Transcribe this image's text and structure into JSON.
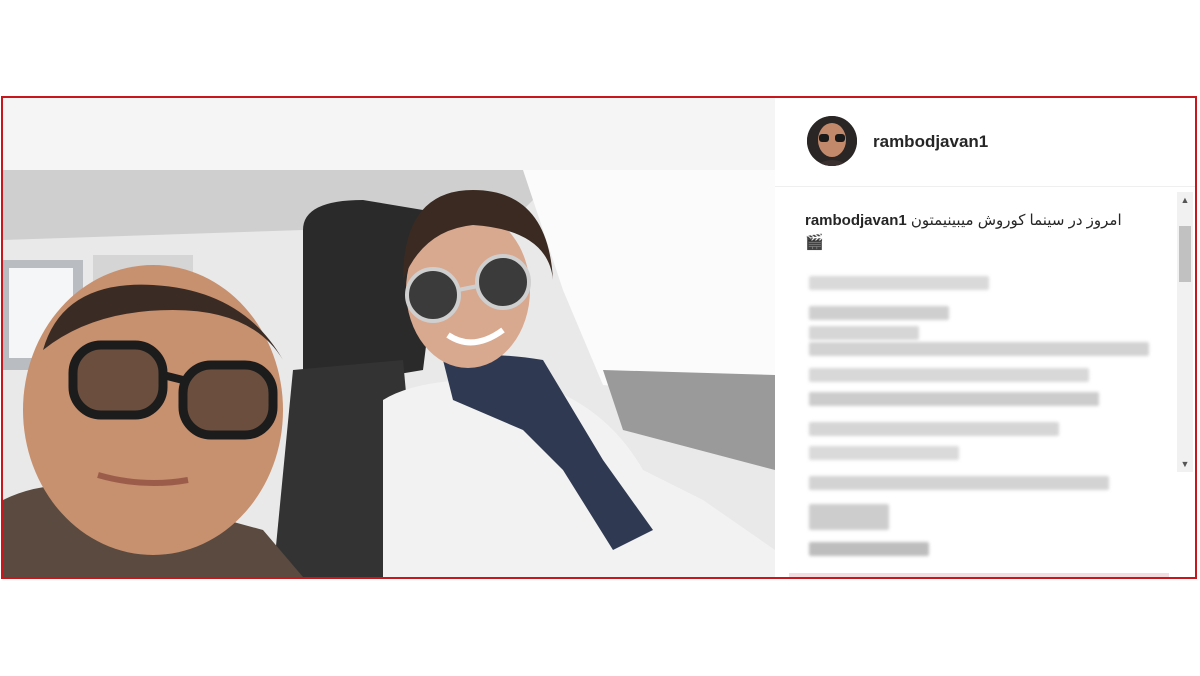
{
  "post": {
    "username": "rambodjavan1",
    "caption_user": "rambodjavan1",
    "caption_text": "امروز در سینما کوروش میبینیمتون",
    "caption_emoji": "🎬"
  },
  "colors": {
    "frame_border": "#c8161d",
    "text": "#262626"
  },
  "icons": {
    "avatar": "profile-photo",
    "scroll_up": "arrow-up-icon",
    "scroll_down": "arrow-down-icon"
  }
}
